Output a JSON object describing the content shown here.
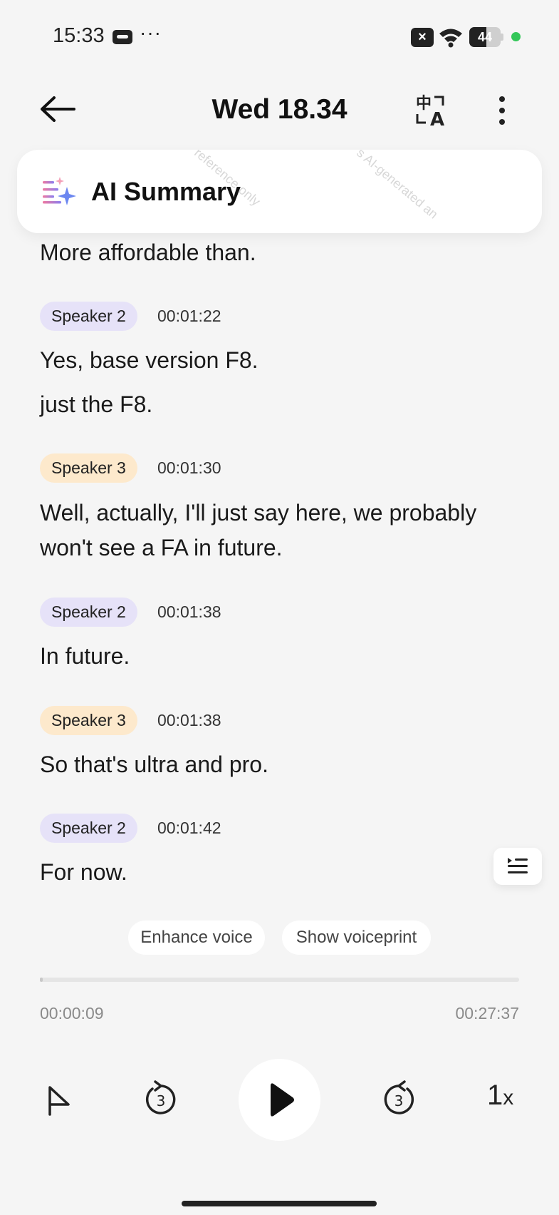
{
  "status_bar": {
    "time": "15:33",
    "dots": "···",
    "battery": "44"
  },
  "header": {
    "title": "Wed 18.34"
  },
  "ai_summary": {
    "title": "AI Summary",
    "watermark_1": "reference only",
    "watermark_2": "s AI-generated an"
  },
  "transcript": {
    "first_line": "More affordable than.",
    "entries": [
      {
        "speaker": "Speaker 2",
        "time": "00:01:22",
        "lines": [
          "Yes, base version F8.",
          "just the F8."
        ]
      },
      {
        "speaker": "Speaker 3",
        "time": "00:01:30",
        "lines": [
          "Well, actually, I'll just say here, we probably",
          "won't see a FA in future."
        ]
      },
      {
        "speaker": "Speaker 2",
        "time": "00:01:38",
        "lines": [
          "In future."
        ]
      },
      {
        "speaker": "Speaker 3",
        "time": "00:01:38",
        "lines": [
          "So that's ultra and pro."
        ]
      },
      {
        "speaker": "Speaker 2",
        "time": "00:01:42",
        "lines": [
          "For now."
        ]
      }
    ]
  },
  "actions": {
    "enhance_voice": "Enhance voice",
    "show_voiceprint": "Show voiceprint"
  },
  "player": {
    "current_time": "00:00:09",
    "total_time": "00:27:37",
    "progress": 0.005,
    "speed": "1",
    "speed_suffix": "x",
    "rewind_seconds": "3",
    "forward_seconds": "3"
  },
  "colors": {
    "speaker_2_badge": "#e6e2f8",
    "speaker_3_badge": "#fde9cc",
    "status_dot": "#34c759"
  },
  "icons": {
    "back": "arrow-left-icon",
    "translate": "translate-icon",
    "more": "more-vertical-icon",
    "ai": "sparkle-list-icon",
    "outline": "list-indent-icon",
    "flag": "flag-icon",
    "rewind": "rewind-3s-icon",
    "forward": "forward-3s-icon",
    "play": "play-icon"
  }
}
